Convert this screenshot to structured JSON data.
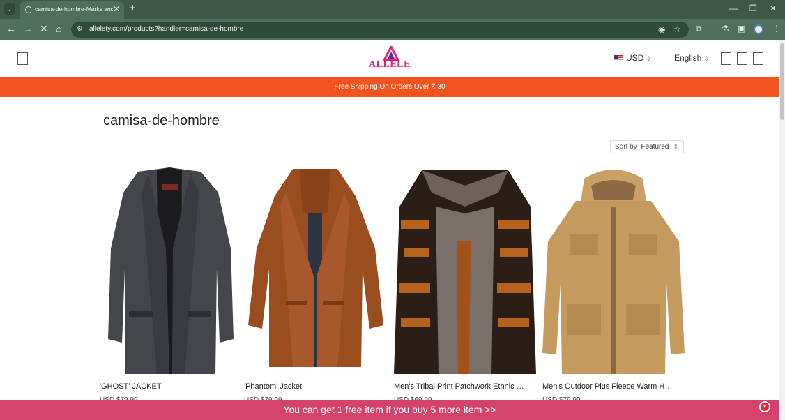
{
  "browser": {
    "tab_title": "camisa-de-hombre-Marks and",
    "url": "allelety.com/products?handler=camisa-de-hombre",
    "new_tab": "+",
    "tab_close": "✕"
  },
  "header": {
    "logo_text": "ALLELE",
    "currency": "USD",
    "language": "English"
  },
  "promo": {
    "text": "Free Shipping On Orders Over ₹ 30"
  },
  "collection": {
    "title": "camisa-de-hombre",
    "sort_label": "Sort by",
    "sort_value": "Featured"
  },
  "products": [
    {
      "name": "'GHOST' JACKET",
      "price": "USD $79.99"
    },
    {
      "name": "'Phantom' Jacket",
      "price": "USD $79.99"
    },
    {
      "name": "Men's Tribal Print Patchwork Ethnic Jacket",
      "price": "USD $69.99"
    },
    {
      "name": "Men's Outdoor Plus Fleece Warm Hooded Jacket",
      "price": "USD $79.99"
    }
  ],
  "bottom_bar": {
    "text": "You can get 1 free item if you buy 5 more item  >>"
  },
  "colors": {
    "promo_bg": "#f3541f",
    "bottom_bar_bg": "#d4436b",
    "logo": "#e21f74",
    "browser_chrome": "#4e6f5b"
  }
}
